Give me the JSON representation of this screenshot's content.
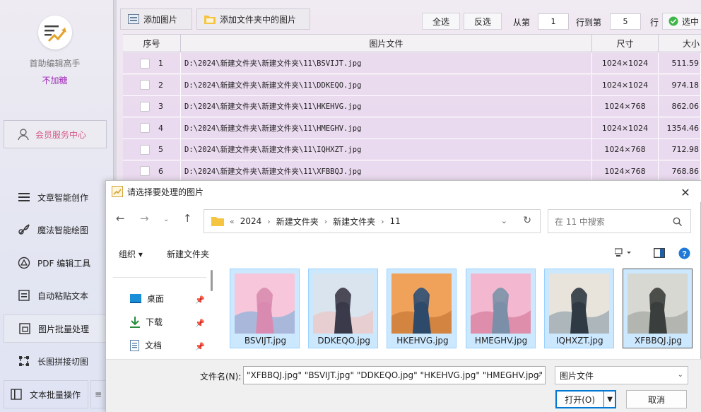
{
  "sidebar": {
    "app_name": "首助编辑高手",
    "slogan": "不加糖",
    "member_center": "会员服务中心",
    "nav": [
      {
        "label": "文章智能创作",
        "icon": "list-lines-icon"
      },
      {
        "label": "魔法智能绘图",
        "icon": "magic-brush-icon"
      },
      {
        "label": "PDF 编辑工具",
        "icon": "pdf-tool-icon"
      },
      {
        "label": "自动粘贴文本",
        "icon": "paste-text-icon"
      },
      {
        "label": "图片批量处理",
        "icon": "image-batch-icon"
      },
      {
        "label": "长图拼接切图",
        "icon": "crop-frame-icon"
      },
      {
        "label": "文本批量操作",
        "icon": "text-batch-icon"
      }
    ],
    "active_index": 4
  },
  "toolbar": {
    "add_image": "添加图片",
    "add_folder": "添加文件夹中的图片",
    "select_all": "全选",
    "invert": "反选",
    "from_label": "从第",
    "from_value": "1",
    "to_label": "行到第",
    "to_value": "5",
    "row_label": "行",
    "select_label": "选中"
  },
  "table": {
    "headers": [
      "序号",
      "图片文件",
      "尺寸",
      "大小"
    ],
    "rows": [
      {
        "no": "1",
        "file": "D:\\2024\\新建文件夹\\新建文件夹\\11\\BSVIJT.jpg",
        "size": "1024×1024",
        "bytes": "511.59"
      },
      {
        "no": "2",
        "file": "D:\\2024\\新建文件夹\\新建文件夹\\11\\DDKEQO.jpg",
        "size": "1024×1024",
        "bytes": "974.18"
      },
      {
        "no": "3",
        "file": "D:\\2024\\新建文件夹\\新建文件夹\\11\\HKEHVG.jpg",
        "size": "1024×768",
        "bytes": "862.06"
      },
      {
        "no": "4",
        "file": "D:\\2024\\新建文件夹\\新建文件夹\\11\\HMEGHV.jpg",
        "size": "1024×1024",
        "bytes": "1354.46"
      },
      {
        "no": "5",
        "file": "D:\\2024\\新建文件夹\\新建文件夹\\11\\IQHXZT.jpg",
        "size": "1024×768",
        "bytes": "712.98"
      },
      {
        "no": "6",
        "file": "D:\\2024\\新建文件夹\\新建文件夹\\11\\XFBBQJ.jpg",
        "size": "1024×768",
        "bytes": "768.86"
      }
    ]
  },
  "dialog": {
    "title": "请选择要处理的图片",
    "path": [
      "2024",
      "新建文件夹",
      "新建文件夹",
      "11"
    ],
    "path_prefix": "«",
    "search_placeholder": "在 11 中搜索",
    "organize": "组织 ▾",
    "new_folder": "新建文件夹",
    "nav_items": [
      "桌面",
      "下载",
      "文档"
    ],
    "files": [
      {
        "name": "BSVIJT.jpg",
        "colors": [
          "#f7c6da",
          "#d98ab0",
          "#8fb3d9"
        ]
      },
      {
        "name": "DDKEQO.jpg",
        "colors": [
          "#d9e4ee",
          "#3a3a4a",
          "#e9c7c7"
        ]
      },
      {
        "name": "HKEHVG.jpg",
        "colors": [
          "#f0a25a",
          "#2e4a6b",
          "#c97a3a"
        ]
      },
      {
        "name": "HMEGHV.jpg",
        "colors": [
          "#f3b8cf",
          "#7b8fa8",
          "#d7809f"
        ]
      },
      {
        "name": "IQHXZT.jpg",
        "colors": [
          "#e8e4dc",
          "#2f3a44",
          "#9aa8b0"
        ]
      },
      {
        "name": "XFBBQJ.jpg",
        "colors": [
          "#d8d8d2",
          "#3a3e3c",
          "#a7aaa5"
        ]
      }
    ],
    "filename_label": "文件名(N):",
    "filename_value": "\"XFBBQJ.jpg\" \"BSVIJT.jpg\" \"DDKEQO.jpg\" \"HKEHVG.jpg\" \"HMEGHV.jpg\" \"IQ",
    "filetype": "图片文件",
    "open": "打开(O)",
    "cancel": "取消"
  }
}
